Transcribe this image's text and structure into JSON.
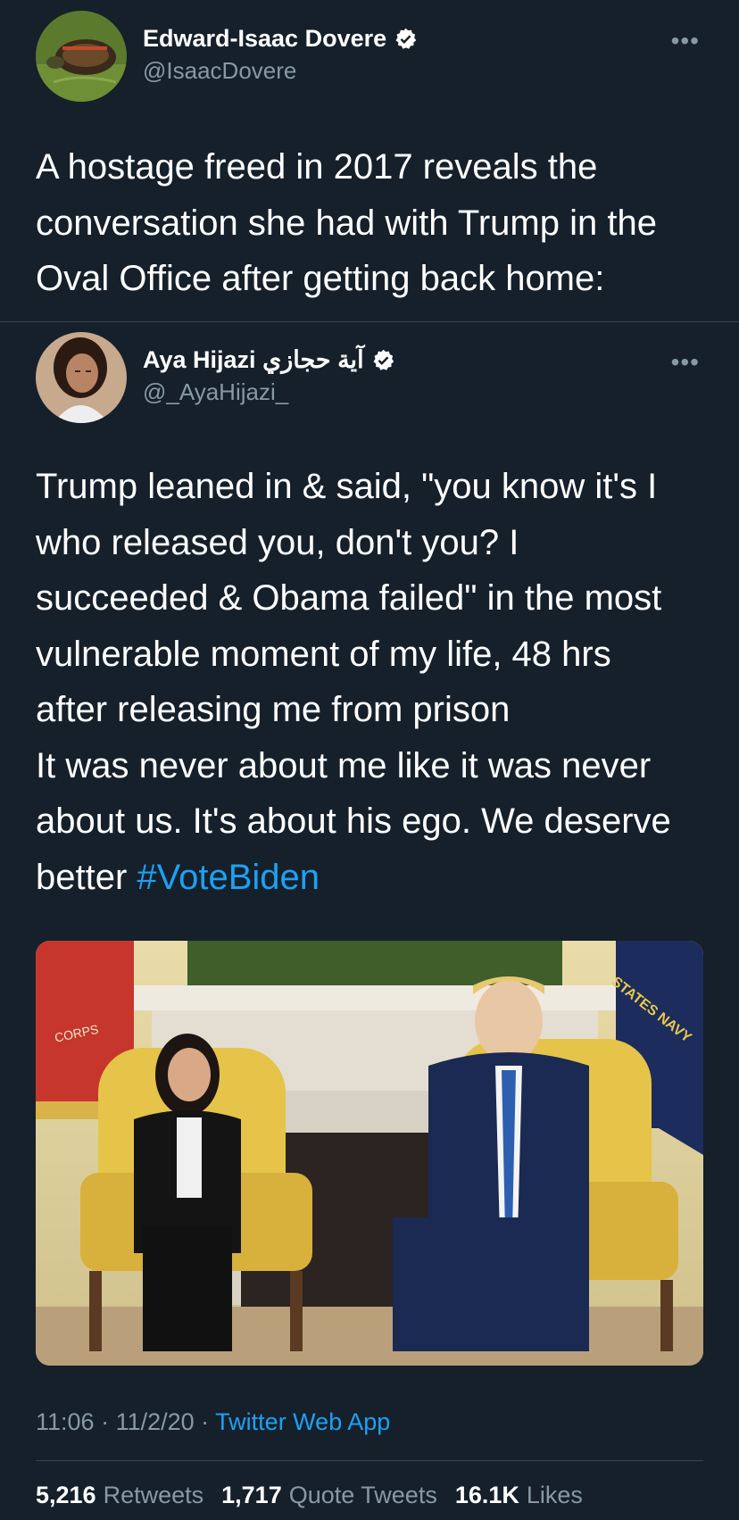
{
  "tweet": {
    "author_name": "Edward-Isaac Dovere",
    "author_handle": "@IsaacDovere",
    "text": "A hostage freed in 2017 reveals the\nconversation she had with Trump in the\nOval Office after getting back home:",
    "more_label": "•••"
  },
  "quoted": {
    "author_name": "Aya Hijazi آية حجازي",
    "author_handle": "@_AyaHijazi_",
    "text": "Trump leaned in & said, \"you know it's I\nwho released you, don't you? I\nsucceeded & Obama failed\" in the most\nvulnerable moment of my life, 48 hrs\nafter releasing me from prison\nIt was never about me like it was never\nabout us. It's about his ego. We deserve\nbetter ",
    "hashtag": "#VoteBiden",
    "more_label": "•••",
    "photo_flag_left_text": "CORPS",
    "photo_flag_right_text": "STATES NAVY"
  },
  "meta": {
    "time": "11:06",
    "sep1": " · ",
    "date": "11/2/20",
    "sep2": " · ",
    "source": "Twitter Web App"
  },
  "stats": [
    {
      "count": "5,216",
      "label": "Retweets"
    },
    {
      "count": "1,717",
      "label": "Quote Tweets"
    },
    {
      "count": "16.1K",
      "label": "Likes"
    }
  ],
  "colors": {
    "background": "#15202b",
    "accent": "#1da1f2",
    "secondary_text": "#8899a6"
  }
}
